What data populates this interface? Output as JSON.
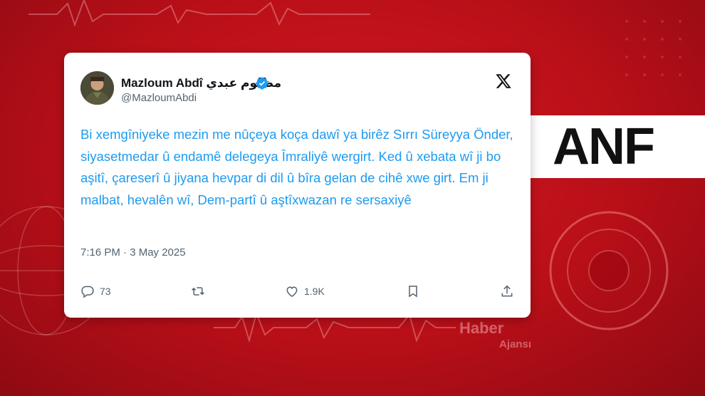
{
  "background": {
    "colors": {
      "primary_red": "#c4141d",
      "dark_red": "#8e0a12"
    },
    "logo_text": "ANF",
    "agency_word1": "Haber",
    "agency_word2": "Ajansı"
  },
  "tweet": {
    "author_name": "Mazloum Abdî مظلوم عبدي",
    "verified_icon": "verified-badge-icon",
    "handle": "@MazloumAbdi",
    "platform_icon": "x-logo-icon",
    "text": "Bi xemgîniyeke mezin me nûçeya koça dawî ya birêz Sırrı Süreyya Önder, siyasetmedar û endamê delegeya Îmraliyê wergirt. Ked û xebata wî ji bo aşitî, çareserî û jiyana hevpar di dil û bîra gelan de cihê xwe girt. Em ji malbat, hevalên wî, Dem-partî û aştîxwazan re sersaxiyê",
    "timestamp": "7:16 PM · 3 May 2025",
    "actions": {
      "reply_count": "73",
      "retweet_count": "",
      "like_count": "1.9K"
    },
    "link_color": "#1d9bf0"
  }
}
